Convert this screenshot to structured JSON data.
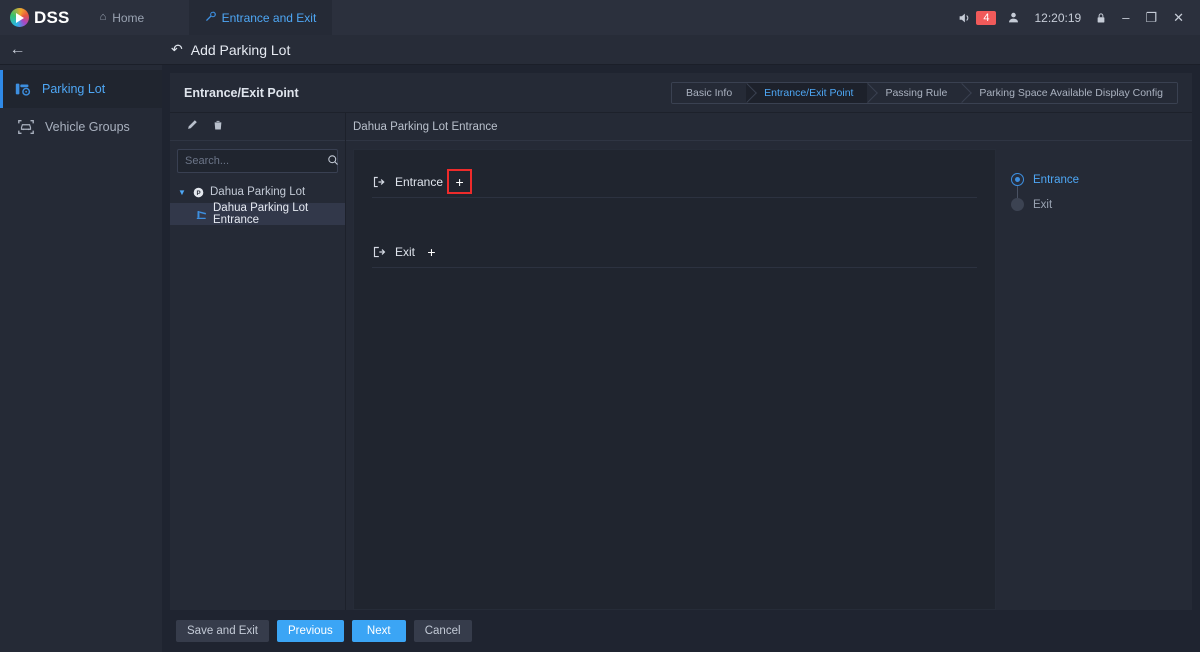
{
  "titlebar": {
    "logo_text": "DSS",
    "tabs": [
      {
        "label": "Home",
        "icon": "home-icon",
        "active": false
      },
      {
        "label": "Entrance and Exit",
        "icon": "wrench-icon",
        "active": true
      }
    ],
    "alarm_count": "4",
    "time": "12:20:19",
    "icons": {
      "speaker": "speaker-icon",
      "user": "user-icon",
      "lock": "lock-icon",
      "minimize": "minimize-icon",
      "maximize": "maximize-icon",
      "close": "close-icon"
    },
    "accent_color": "#4ea7f5",
    "alarm_color": "#f05a5a"
  },
  "subheader": {
    "back_icon": "back-arrow-icon",
    "title_icon": "undo-icon",
    "title": "Add Parking Lot"
  },
  "sidebar": {
    "items": [
      {
        "label": "Parking Lot",
        "icon": "parking-barrier-icon",
        "active": true
      },
      {
        "label": "Vehicle Groups",
        "icon": "vehicle-scan-icon",
        "active": false
      }
    ]
  },
  "panel": {
    "title": "Entrance/Exit Point",
    "steps": [
      {
        "label": "Basic Info",
        "active": false
      },
      {
        "label": "Entrance/Exit Point",
        "active": true
      },
      {
        "label": "Passing Rule",
        "active": false
      },
      {
        "label": "Parking Space Available Display Config",
        "active": false
      }
    ]
  },
  "tree_panel": {
    "tools": [
      {
        "name": "edit-icon",
        "glyph": "✎"
      },
      {
        "name": "delete-icon",
        "glyph": "🗑"
      }
    ],
    "search": {
      "value": "",
      "placeholder": "Search..."
    },
    "nodes": [
      {
        "label": "Dahua Parking Lot",
        "icon": "parking-p-icon",
        "level": 0,
        "expanded": true,
        "selected": false
      },
      {
        "label": "Dahua Parking Lot Entrance",
        "icon": "barrier-icon",
        "level": 1,
        "expanded": false,
        "selected": true
      }
    ]
  },
  "content": {
    "breadcrumb": "Dahua Parking Lot Entrance",
    "sections": [
      {
        "label": "Entrance",
        "icon": "door-enter-icon",
        "add_label": "+",
        "highlighted": true
      },
      {
        "label": "Exit",
        "icon": "door-exit-icon",
        "add_label": "+",
        "highlighted": false
      }
    ],
    "highlight_color": "#ee2b2b"
  },
  "anchors": {
    "items": [
      {
        "label": "Entrance",
        "active": true
      },
      {
        "label": "Exit",
        "active": false
      }
    ]
  },
  "footer": {
    "buttons": [
      {
        "label": "Save and Exit",
        "style": "dark"
      },
      {
        "label": "Previous",
        "style": "primary"
      },
      {
        "label": "Next",
        "style": "primary"
      },
      {
        "label": "Cancel",
        "style": "dark"
      }
    ]
  }
}
